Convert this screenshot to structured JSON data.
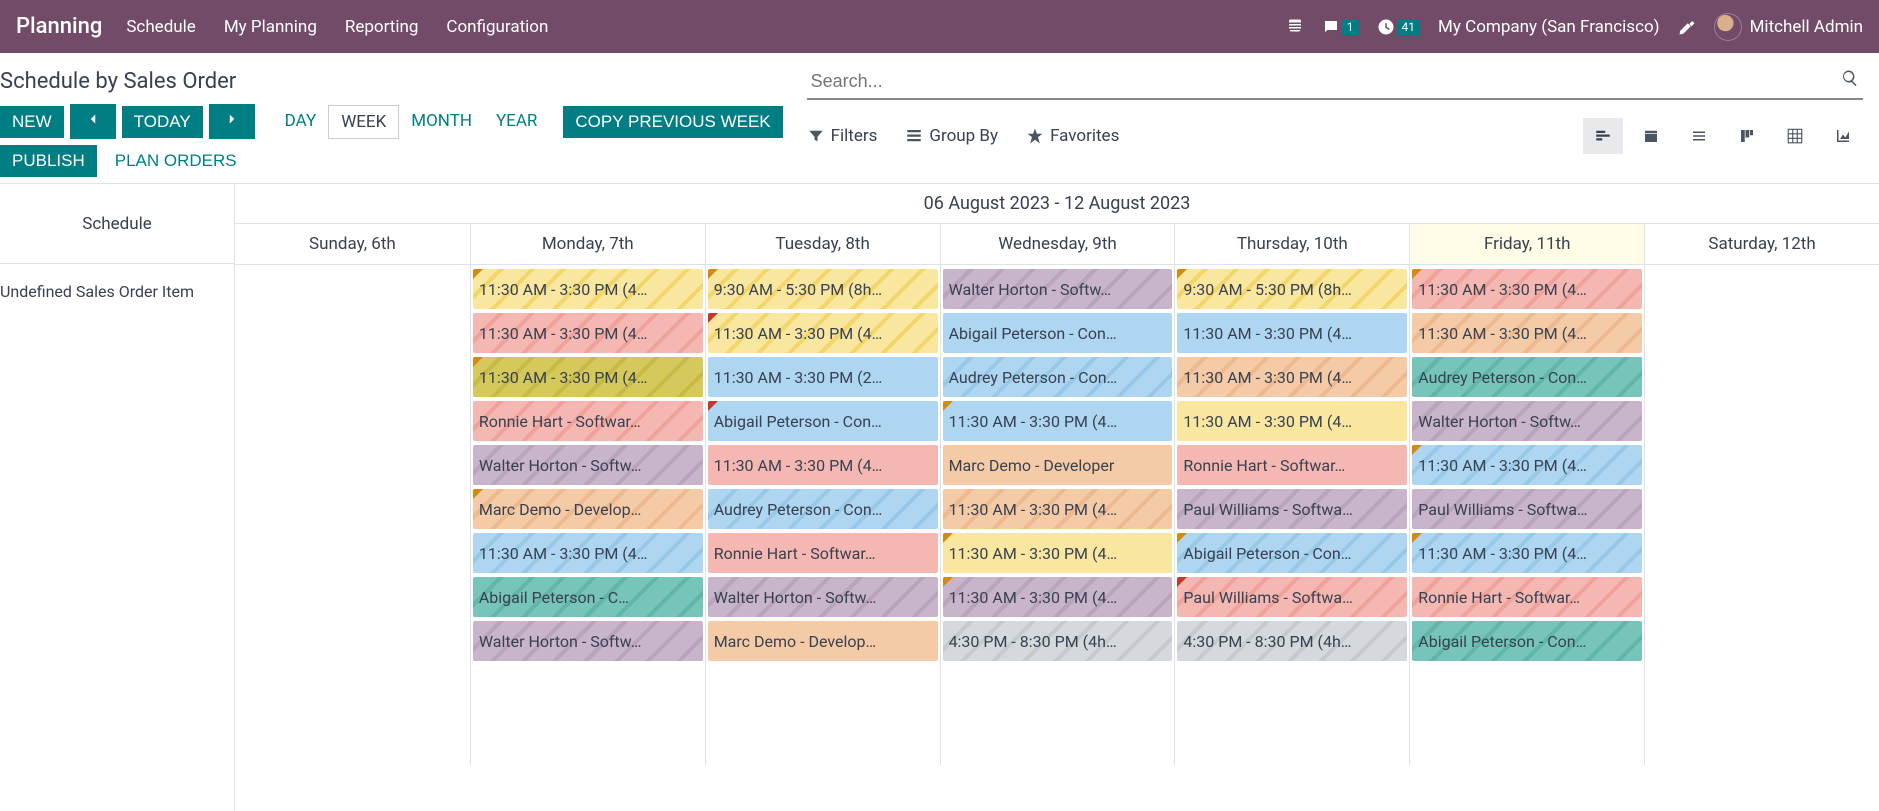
{
  "nav": {
    "brand": "Planning",
    "menu": [
      "Schedule",
      "My Planning",
      "Reporting",
      "Configuration"
    ],
    "chat_badge": "1",
    "activity_badge": "41",
    "company": "My Company (San Francisco)",
    "user": "Mitchell Admin"
  },
  "breadcrumb": "Schedule by Sales Order",
  "toolbar": {
    "new_btn": "NEW",
    "today_btn": "TODAY",
    "ranges": {
      "day": "DAY",
      "week": "WEEK",
      "month": "MONTH",
      "year": "YEAR"
    },
    "copy_prev": "COPY PREVIOUS WEEK",
    "publish": "PUBLISH",
    "plan_orders": "PLAN ORDERS"
  },
  "search": {
    "placeholder": "Search..."
  },
  "filterbar": {
    "filters": "Filters",
    "groupby": "Group By",
    "favorites": "Favorites"
  },
  "gantt": {
    "left_header": "Schedule",
    "row_label": "Undefined Sales Order Item",
    "date_range": "06 August 2023 - 12 August 2023",
    "days": [
      {
        "label": "Sunday, 6th",
        "today": false
      },
      {
        "label": "Monday, 7th",
        "today": false
      },
      {
        "label": "Tuesday, 8th",
        "today": false
      },
      {
        "label": "Wednesday, 9th",
        "today": false
      },
      {
        "label": "Thursday, 10th",
        "today": false
      },
      {
        "label": "Friday, 11th",
        "today": true
      },
      {
        "label": "Saturday, 12th",
        "today": false
      }
    ],
    "columns": [
      [],
      [
        {
          "text": "11:30 AM - 3:30 PM (4…",
          "color": "yellow",
          "stripe": true,
          "corner": "orange"
        },
        {
          "text": "11:30 AM - 3:30 PM (4…",
          "color": "pink",
          "stripe": true,
          "corner": ""
        },
        {
          "text": "11:30 AM - 3:30 PM (4…",
          "color": "olive",
          "stripe": true,
          "corner": "orange"
        },
        {
          "text": "Ronnie Hart - Softwar…",
          "color": "pink",
          "stripe": true,
          "corner": ""
        },
        {
          "text": "Walter Horton - Softw…",
          "color": "purple",
          "stripe": true,
          "corner": ""
        },
        {
          "text": "Marc Demo - Develop…",
          "color": "orange",
          "stripe": true,
          "corner": "orange"
        },
        {
          "text": "11:30 AM - 3:30 PM (4…",
          "color": "blue",
          "stripe": true,
          "corner": ""
        },
        {
          "text": "Abigail Peterson - C…",
          "color": "teal",
          "stripe": true,
          "corner": ""
        },
        {
          "text": "Walter Horton - Softw…",
          "color": "purple",
          "stripe": true,
          "corner": ""
        }
      ],
      [
        {
          "text": "9:30 AM - 5:30 PM (8h…",
          "color": "yellow",
          "stripe": true,
          "corner": "orange"
        },
        {
          "text": "11:30 AM - 3:30 PM (4…",
          "color": "yellow",
          "stripe": true,
          "corner": "red"
        },
        {
          "text": "11:30 AM - 3:30 PM (2…",
          "color": "blue",
          "stripe": false,
          "corner": ""
        },
        {
          "text": "Abigail Peterson - Con…",
          "color": "blue",
          "stripe": false,
          "corner": "red"
        },
        {
          "text": "11:30 AM - 3:30 PM (4…",
          "color": "pink",
          "stripe": false,
          "corner": ""
        },
        {
          "text": "Audrey Peterson - Con…",
          "color": "blue",
          "stripe": true,
          "corner": ""
        },
        {
          "text": "Ronnie Hart - Softwar…",
          "color": "pink",
          "stripe": false,
          "corner": ""
        },
        {
          "text": "Walter Horton - Softw…",
          "color": "purple",
          "stripe": true,
          "corner": ""
        },
        {
          "text": "Marc Demo - Develop…",
          "color": "orange",
          "stripe": false,
          "corner": ""
        }
      ],
      [
        {
          "text": "Walter Horton - Softw…",
          "color": "purple",
          "stripe": true,
          "corner": ""
        },
        {
          "text": "Abigail Peterson - Con…",
          "color": "blue",
          "stripe": false,
          "corner": ""
        },
        {
          "text": "Audrey Peterson - Con…",
          "color": "blue",
          "stripe": true,
          "corner": ""
        },
        {
          "text": "11:30 AM - 3:30 PM (4…",
          "color": "blue",
          "stripe": false,
          "corner": "orange"
        },
        {
          "text": "Marc Demo - Developer",
          "color": "orange",
          "stripe": false,
          "corner": ""
        },
        {
          "text": "11:30 AM - 3:30 PM (4…",
          "color": "orange",
          "stripe": true,
          "corner": ""
        },
        {
          "text": "11:30 AM - 3:30 PM (4…",
          "color": "yellow",
          "stripe": false,
          "corner": "orange"
        },
        {
          "text": "11:30 AM - 3:30 PM (4…",
          "color": "purple",
          "stripe": true,
          "corner": "orange"
        },
        {
          "text": "4:30 PM - 8:30 PM (4h…",
          "color": "grey",
          "stripe": true,
          "corner": ""
        }
      ],
      [
        {
          "text": "9:30 AM - 5:30 PM (8h…",
          "color": "yellow",
          "stripe": true,
          "corner": "orange"
        },
        {
          "text": "11:30 AM - 3:30 PM (4…",
          "color": "blue",
          "stripe": false,
          "corner": ""
        },
        {
          "text": "11:30 AM - 3:30 PM (4…",
          "color": "orange",
          "stripe": true,
          "corner": ""
        },
        {
          "text": "11:30 AM - 3:30 PM (4…",
          "color": "yellow",
          "stripe": false,
          "corner": ""
        },
        {
          "text": "Ronnie Hart - Softwar…",
          "color": "pink",
          "stripe": false,
          "corner": ""
        },
        {
          "text": "Paul Williams - Softwa…",
          "color": "purple",
          "stripe": true,
          "corner": ""
        },
        {
          "text": "Abigail Peterson - Con…",
          "color": "blue",
          "stripe": true,
          "corner": "orange"
        },
        {
          "text": "Paul Williams - Softwa…",
          "color": "pink",
          "stripe": true,
          "corner": "red"
        },
        {
          "text": "4:30 PM - 8:30 PM (4h…",
          "color": "grey",
          "stripe": true,
          "corner": ""
        }
      ],
      [
        {
          "text": "11:30 AM - 3:30 PM (4…",
          "color": "pink",
          "stripe": true,
          "corner": "orange"
        },
        {
          "text": "11:30 AM - 3:30 PM (4…",
          "color": "orange",
          "stripe": true,
          "corner": ""
        },
        {
          "text": "Audrey Peterson - Con…",
          "color": "teal",
          "stripe": true,
          "corner": ""
        },
        {
          "text": "Walter Horton - Softw…",
          "color": "purple",
          "stripe": true,
          "corner": ""
        },
        {
          "text": "11:30 AM - 3:30 PM (4…",
          "color": "blue",
          "stripe": true,
          "corner": "orange"
        },
        {
          "text": "Paul Williams - Softwa…",
          "color": "purple",
          "stripe": true,
          "corner": ""
        },
        {
          "text": "11:30 AM - 3:30 PM (4…",
          "color": "blue",
          "stripe": true,
          "corner": "orange"
        },
        {
          "text": "Ronnie Hart - Softwar…",
          "color": "pink",
          "stripe": true,
          "corner": ""
        },
        {
          "text": "Abigail Peterson - Con…",
          "color": "teal",
          "stripe": true,
          "corner": ""
        }
      ],
      []
    ]
  }
}
